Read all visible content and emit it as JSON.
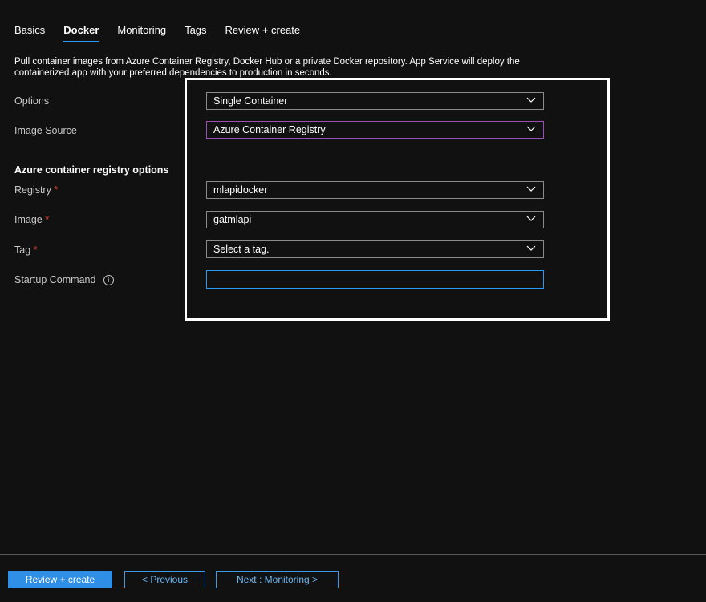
{
  "tabs": [
    {
      "label": "Basics",
      "active": false
    },
    {
      "label": "Docker",
      "active": true
    },
    {
      "label": "Monitoring",
      "active": false
    },
    {
      "label": "Tags",
      "active": false
    },
    {
      "label": "Review + create",
      "active": false
    }
  ],
  "description": "Pull container images from Azure Container Registry, Docker Hub or a private Docker repository. App Service will deploy the containerized app with your preferred dependencies to production in seconds.",
  "fields": {
    "options": {
      "label": "Options",
      "value": "Single Container"
    },
    "image_source": {
      "label": "Image Source",
      "value": "Azure Container Registry"
    },
    "section_heading": "Azure container registry options",
    "registry": {
      "label": "Registry",
      "required_mark": "*",
      "value": "mlapidocker"
    },
    "image": {
      "label": "Image",
      "required_mark": "*",
      "value": "gatmlapi"
    },
    "tag": {
      "label": "Tag",
      "required_mark": "*",
      "value": "Select a tag."
    },
    "startup_command": {
      "label": "Startup Command",
      "info_glyph": "i",
      "value": ""
    }
  },
  "footer": {
    "review_create": "Review + create",
    "previous": "< Previous",
    "next": "Next : Monitoring >"
  },
  "colors": {
    "background": "#111111",
    "accent": "#2899f5",
    "focus_border": "#9b4fb5",
    "required": "#e8473b",
    "primary_button": "#2f8fe6"
  },
  "icons": {
    "dropdown": "chevron-down-icon",
    "info": "info-icon"
  }
}
